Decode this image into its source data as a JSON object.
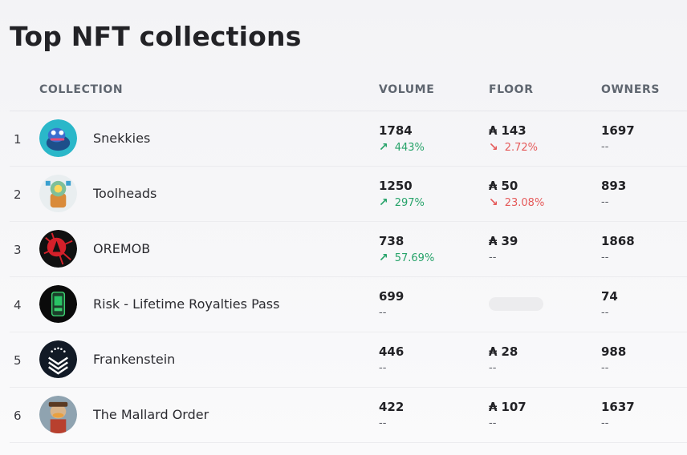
{
  "page": {
    "title": "Top NFT collections"
  },
  "header": {
    "collection": "COLLECTION",
    "volume": "VOLUME",
    "floor": "FLOOR",
    "owners": "OWNERS"
  },
  "currency_symbol": "₳",
  "rows": [
    {
      "rank": "1",
      "name": "Snekkies",
      "volume": "1784",
      "volume_change": "443%",
      "volume_dir": "up",
      "floor": "143",
      "floor_change": "2.72%",
      "floor_dir": "down",
      "owners": "1697",
      "owners_change": "--"
    },
    {
      "rank": "2",
      "name": "Toolheads",
      "volume": "1250",
      "volume_change": "297%",
      "volume_dir": "up",
      "floor": "50",
      "floor_change": "23.08%",
      "floor_dir": "down",
      "owners": "893",
      "owners_change": "--"
    },
    {
      "rank": "3",
      "name": "OREMOB",
      "volume": "738",
      "volume_change": "57.69%",
      "volume_dir": "up",
      "floor": "39",
      "floor_change": "--",
      "owners": "1868",
      "owners_change": "--"
    },
    {
      "rank": "4",
      "name": "Risk - Lifetime Royalties Pass",
      "volume": "699",
      "volume_change": "--",
      "floor_loading": true,
      "owners": "74",
      "owners_change": "--"
    },
    {
      "rank": "5",
      "name": "Frankenstein",
      "volume": "446",
      "volume_change": "--",
      "floor": "28",
      "floor_change": "--",
      "owners": "988",
      "owners_change": "--"
    },
    {
      "rank": "6",
      "name": "The Mallard Order",
      "volume": "422",
      "volume_change": "--",
      "floor": "107",
      "floor_change": "--",
      "owners": "1637",
      "owners_change": "--"
    }
  ],
  "icons": {
    "up": "arrow-up-right-icon",
    "down": "arrow-down-right-icon",
    "currency": "ada-icon"
  },
  "colors": {
    "up": "#27a36a",
    "down": "#e55a5a",
    "text": "#222226",
    "muted": "#5f6670"
  }
}
